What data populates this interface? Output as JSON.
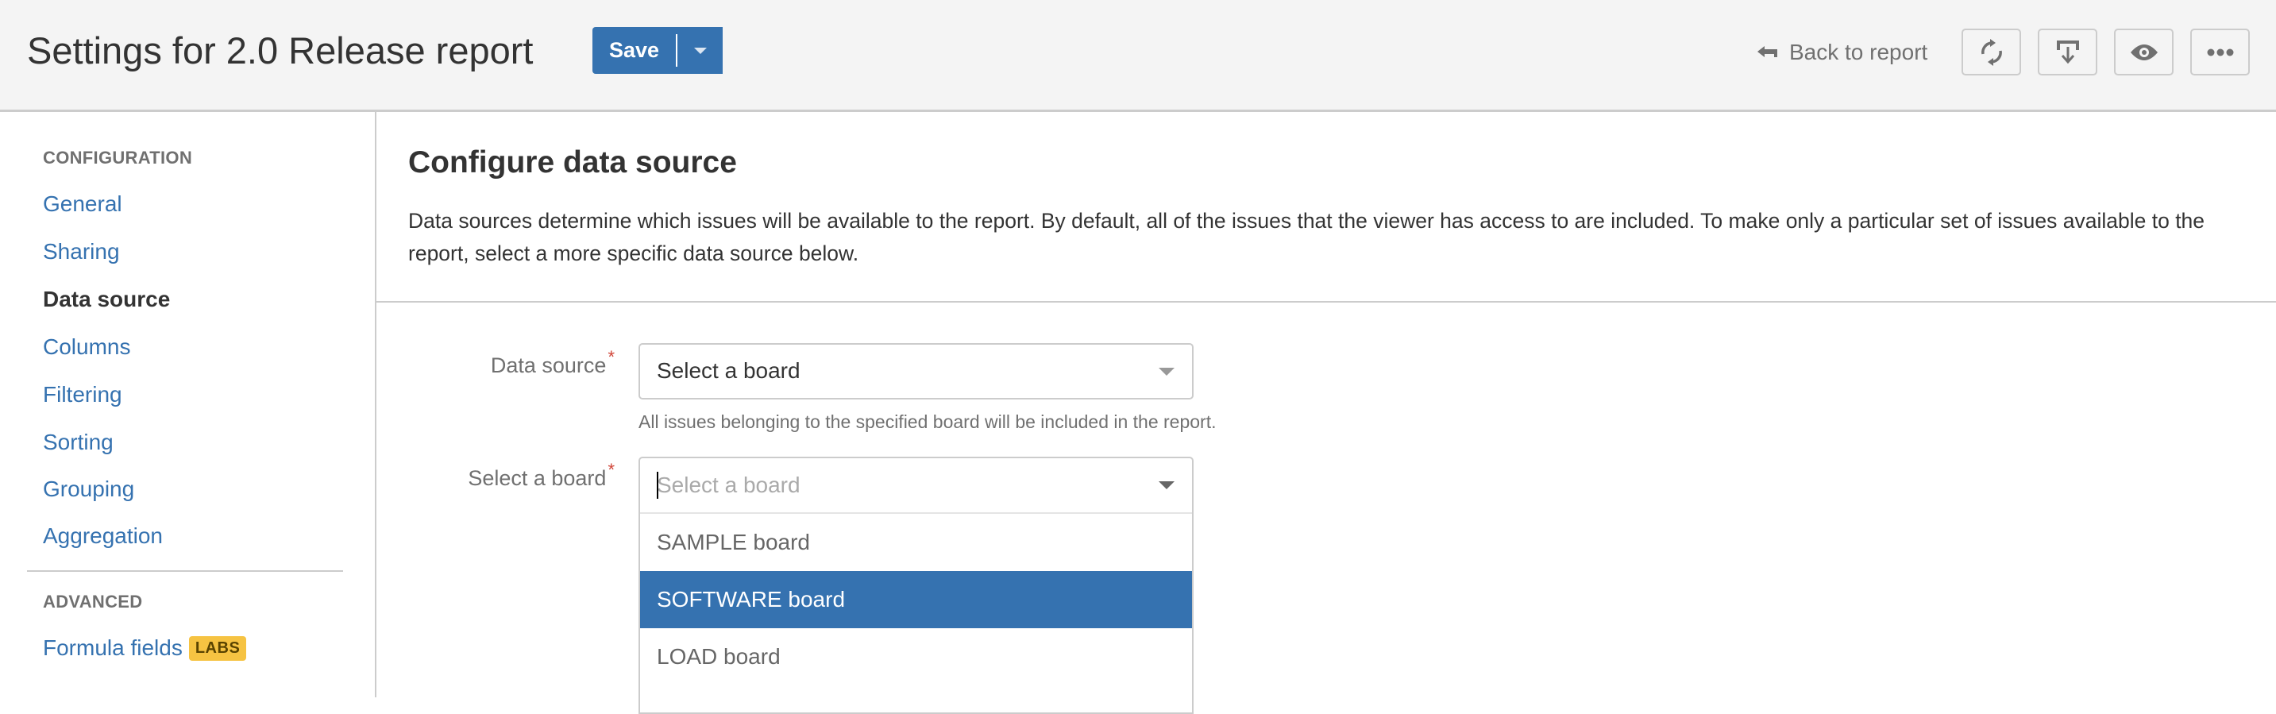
{
  "header": {
    "title": "Settings for 2.0 Release report",
    "save_label": "Save",
    "save_menu_icon": "chevron-down-icon",
    "back_label": "Back to report",
    "back_icon": "arrow-left-icon",
    "icon_buttons": [
      {
        "name": "refresh",
        "icon": "refresh-icon"
      },
      {
        "name": "export",
        "icon": "download-icon"
      },
      {
        "name": "preview",
        "icon": "eye-icon"
      },
      {
        "name": "more",
        "icon": "ellipsis-icon"
      }
    ]
  },
  "sidebar": {
    "sections": [
      {
        "heading": "CONFIGURATION",
        "items": [
          {
            "label": "General",
            "active": false
          },
          {
            "label": "Sharing",
            "active": false
          },
          {
            "label": "Data source",
            "active": true
          },
          {
            "label": "Columns",
            "active": false
          },
          {
            "label": "Filtering",
            "active": false
          },
          {
            "label": "Sorting",
            "active": false
          },
          {
            "label": "Grouping",
            "active": false
          },
          {
            "label": "Aggregation",
            "active": false
          }
        ]
      },
      {
        "heading": "ADVANCED",
        "items": [
          {
            "label": "Formula fields",
            "badge": "LABS",
            "active": false
          }
        ]
      }
    ]
  },
  "main": {
    "title": "Configure data source",
    "description": "Data sources determine which issues will be available to the report. By default, all of the issues that the viewer has access to are included. To make only a particular set of issues available to the report, select a more specific data source below.",
    "fields": {
      "data_source": {
        "label": "Data source",
        "required_mark": "*",
        "value": "Select a board",
        "help": "All issues belonging to the specified board will be included in the report."
      },
      "board": {
        "label": "Select a board",
        "required_mark": "*",
        "value": "",
        "placeholder": "Select a board",
        "options": [
          "SAMPLE board",
          "SOFTWARE board",
          "LOAD board"
        ],
        "highlighted": "SOFTWARE board"
      }
    }
  },
  "colors": {
    "accent": "#3572b0",
    "required": "#d04437",
    "badge": "#f6c342"
  }
}
